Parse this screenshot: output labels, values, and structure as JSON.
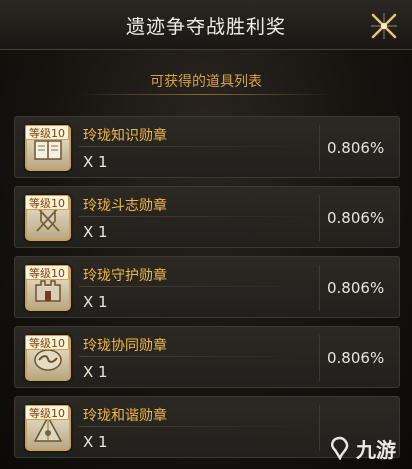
{
  "header": {
    "title": "遗迹争夺战胜利奖",
    "close_icon": "close-x-icon",
    "accent": "#f0b84a"
  },
  "subtitle": "可获得的道具列表",
  "items": [
    {
      "level": "等级10",
      "name": "玲珑知识勋章",
      "qty": "X 1",
      "rate": "0.806%",
      "icon": "book-icon"
    },
    {
      "level": "等级10",
      "name": "玲珑斗志勋章",
      "qty": "X 1",
      "rate": "0.806%",
      "icon": "crossed-swords-shield-icon"
    },
    {
      "level": "等级10",
      "name": "玲珑守护勋章",
      "qty": "X 1",
      "rate": "0.806%",
      "icon": "fortress-icon"
    },
    {
      "level": "等级10",
      "name": "玲珑协同勋章",
      "qty": "X 1",
      "rate": "0.806%",
      "icon": "handshake-icon"
    },
    {
      "level": "等级10",
      "name": "玲珑和谐勋章",
      "qty": "X 1",
      "rate": "",
      "icon": "pyramid-icon"
    }
  ],
  "watermark": {
    "text": "九游",
    "icon": "logo-icon"
  }
}
